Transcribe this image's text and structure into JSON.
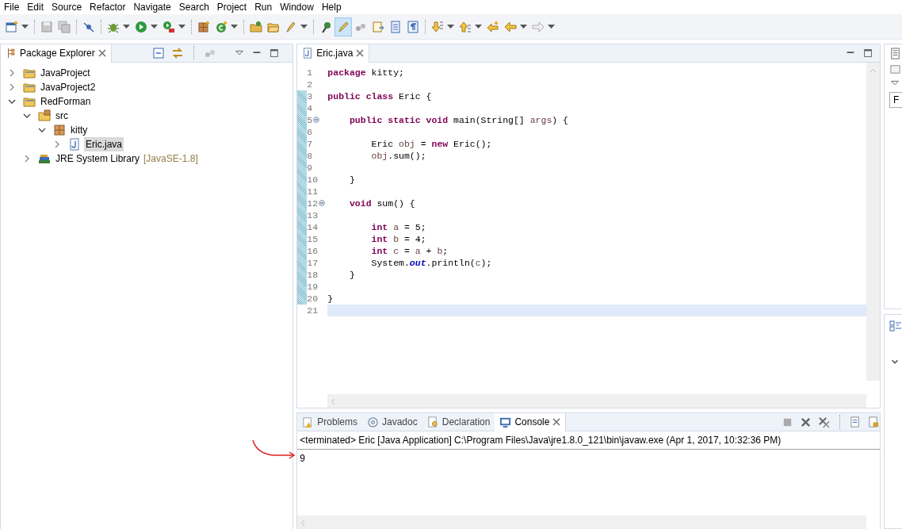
{
  "menu": [
    "File",
    "Edit",
    "Source",
    "Refactor",
    "Navigate",
    "Search",
    "Project",
    "Run",
    "Window",
    "Help"
  ],
  "toolbar": [
    {
      "kind": "new",
      "dropdown": true,
      "pressed": false
    },
    {
      "kind": "separator"
    },
    {
      "kind": "save",
      "dropdown": false,
      "pressed": false
    },
    {
      "kind": "save-all",
      "dropdown": false,
      "pressed": false
    },
    {
      "kind": "separator"
    },
    {
      "kind": "skip",
      "dropdown": false,
      "pressed": false
    },
    {
      "kind": "separator"
    },
    {
      "kind": "debug",
      "dropdown": true,
      "pressed": false
    },
    {
      "kind": "run",
      "dropdown": true,
      "pressed": false
    },
    {
      "kind": "external",
      "dropdown": true,
      "pressed": false
    },
    {
      "kind": "separator"
    },
    {
      "kind": "package",
      "dropdown": false,
      "pressed": false
    },
    {
      "kind": "new-class",
      "dropdown": true,
      "pressed": false
    },
    {
      "kind": "separator"
    },
    {
      "kind": "open-type",
      "dropdown": false,
      "pressed": false
    },
    {
      "kind": "open-folder",
      "dropdown": false,
      "pressed": false
    },
    {
      "kind": "brush",
      "dropdown": true,
      "pressed": false
    },
    {
      "kind": "separator"
    },
    {
      "kind": "pin",
      "dropdown": false,
      "pressed": false
    },
    {
      "kind": "highlight",
      "dropdown": false,
      "pressed": true
    },
    {
      "kind": "dots",
      "dropdown": false,
      "pressed": false
    },
    {
      "kind": "doc",
      "dropdown": false,
      "pressed": false
    },
    {
      "kind": "list",
      "dropdown": false,
      "pressed": false
    },
    {
      "kind": "pilcrow",
      "dropdown": false,
      "pressed": false
    },
    {
      "kind": "separator"
    },
    {
      "kind": "down",
      "dropdown": true,
      "pressed": false
    },
    {
      "kind": "up",
      "dropdown": true,
      "pressed": false
    },
    {
      "kind": "back-edit",
      "dropdown": false,
      "pressed": false
    },
    {
      "kind": "back",
      "dropdown": true,
      "pressed": false
    },
    {
      "kind": "forward",
      "dropdown": true,
      "pressed": false
    }
  ],
  "package_explorer": {
    "title": "Package Explorer",
    "tree": [
      {
        "kind": "project",
        "label": "JavaProject",
        "expanded": false,
        "selected": false
      },
      {
        "kind": "project",
        "label": "JavaProject2",
        "expanded": false,
        "selected": false
      },
      {
        "kind": "project",
        "label": "RedForman",
        "expanded": true,
        "selected": false,
        "children": [
          {
            "kind": "source-folder",
            "label": "src",
            "expanded": true,
            "selected": false,
            "children": [
              {
                "kind": "package",
                "label": "kitty",
                "expanded": true,
                "selected": false,
                "children": [
                  {
                    "kind": "java-file",
                    "label": "Eric.java",
                    "expanded": false,
                    "selected": true
                  }
                ]
              }
            ]
          },
          {
            "kind": "library",
            "label": "JRE System Library",
            "decoration": "[JavaSE-1.8]",
            "expanded": false,
            "selected": false
          }
        ]
      }
    ]
  },
  "editor": {
    "tab": "Eric.java",
    "lines": [
      {
        "number": "1",
        "fold": false,
        "current": false,
        "tokens": [
          {
            "kind": "keyword",
            "text": "package"
          },
          {
            "kind": "plain",
            "text": " kitty;"
          }
        ]
      },
      {
        "number": "2",
        "fold": false,
        "current": false
      },
      {
        "number": "3",
        "fold": false,
        "current": false,
        "tokens": [
          {
            "kind": "keyword",
            "text": "public class"
          },
          {
            "kind": "plain",
            "text": " Eric {"
          }
        ]
      },
      {
        "number": "4",
        "fold": false,
        "current": false
      },
      {
        "number": "5",
        "fold": true,
        "current": false,
        "tokens": [
          {
            "kind": "keyword",
            "text": "    public static void"
          },
          {
            "kind": "plain",
            "text": " main(String[] "
          },
          {
            "kind": "local",
            "text": "args"
          },
          {
            "kind": "plain",
            "text": ") {"
          }
        ]
      },
      {
        "number": "6",
        "fold": false,
        "current": false
      },
      {
        "number": "7",
        "fold": false,
        "current": false,
        "tokens": [
          {
            "kind": "plain",
            "text": "        Eric "
          },
          {
            "kind": "local",
            "text": "obj"
          },
          {
            "kind": "plain",
            "text": " = "
          },
          {
            "kind": "keyword",
            "text": "new"
          },
          {
            "kind": "plain",
            "text": " Eric();"
          }
        ]
      },
      {
        "number": "8",
        "fold": false,
        "current": false,
        "tokens": [
          {
            "kind": "local",
            "text": "        obj"
          },
          {
            "kind": "plain",
            "text": ".sum();"
          }
        ]
      },
      {
        "number": "9",
        "fold": false,
        "current": false
      },
      {
        "number": "10",
        "fold": false,
        "current": false,
        "tokens": [
          {
            "kind": "plain",
            "text": "    }"
          }
        ]
      },
      {
        "number": "11",
        "fold": false,
        "current": false
      },
      {
        "number": "12",
        "fold": true,
        "current": false,
        "tokens": [
          {
            "kind": "keyword",
            "text": "    void"
          },
          {
            "kind": "plain",
            "text": " sum() {"
          }
        ]
      },
      {
        "number": "13",
        "fold": false,
        "current": false
      },
      {
        "number": "14",
        "fold": false,
        "current": false,
        "tokens": [
          {
            "kind": "keyword",
            "text": "        int"
          },
          {
            "kind": "local",
            "text": " a"
          },
          {
            "kind": "plain",
            "text": " = 5;"
          }
        ]
      },
      {
        "number": "15",
        "fold": false,
        "current": false,
        "tokens": [
          {
            "kind": "keyword",
            "text": "        int"
          },
          {
            "kind": "local",
            "text": " b"
          },
          {
            "kind": "plain",
            "text": " = 4;"
          }
        ]
      },
      {
        "number": "16",
        "fold": false,
        "current": false,
        "tokens": [
          {
            "kind": "keyword",
            "text": "        int"
          },
          {
            "kind": "local",
            "text": " c"
          },
          {
            "kind": "plain",
            "text": " = "
          },
          {
            "kind": "local",
            "text": "a"
          },
          {
            "kind": "plain",
            "text": " + "
          },
          {
            "kind": "local",
            "text": "b"
          },
          {
            "kind": "plain",
            "text": ";"
          }
        ]
      },
      {
        "number": "17",
        "fold": false,
        "current": false,
        "tokens": [
          {
            "kind": "plain",
            "text": "        System."
          },
          {
            "kind": "static",
            "text": "out"
          },
          {
            "kind": "plain",
            "text": ".println("
          },
          {
            "kind": "local",
            "text": "c"
          },
          {
            "kind": "plain",
            "text": ");"
          }
        ]
      },
      {
        "number": "18",
        "fold": false,
        "current": false,
        "tokens": [
          {
            "kind": "plain",
            "text": "    }"
          }
        ]
      },
      {
        "number": "19",
        "fold": false,
        "current": false
      },
      {
        "number": "20",
        "fold": false,
        "current": false,
        "tokens": [
          {
            "kind": "plain",
            "text": "}"
          }
        ]
      },
      {
        "number": "21",
        "fold": false,
        "current": true
      }
    ]
  },
  "console": {
    "tabs": [
      {
        "kind": "problems",
        "label": "Problems",
        "selected": false
      },
      {
        "kind": "javadoc",
        "label": "Javadoc",
        "selected": false
      },
      {
        "kind": "declaration",
        "label": "Declaration",
        "selected": false
      },
      {
        "kind": "console",
        "label": "Console",
        "selected": true
      }
    ],
    "header": "<terminated> Eric [Java Application] C:\\Program Files\\Java\\jre1.8.0_121\\bin\\javaw.exe (Apr 1, 2017, 10:32:36 PM)",
    "output": [
      "9"
    ]
  },
  "right_panel": {
    "field_text": "F"
  }
}
